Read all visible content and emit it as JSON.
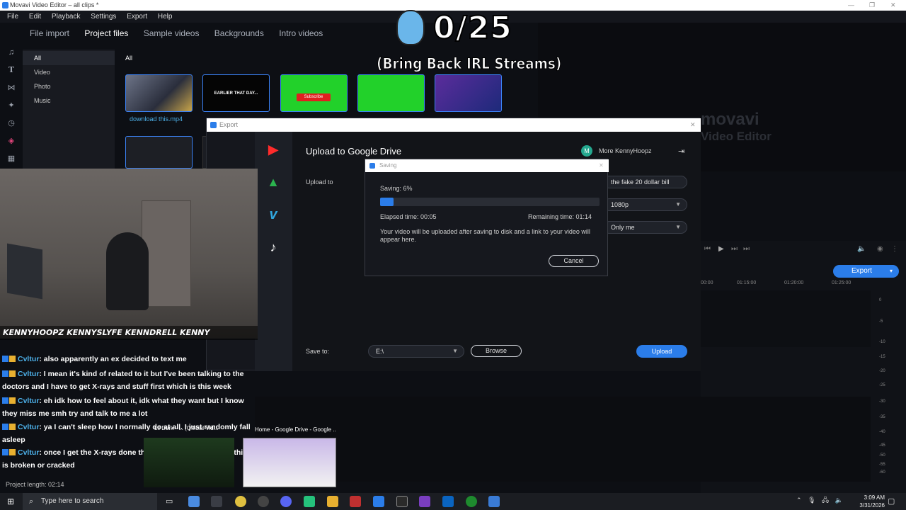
{
  "window": {
    "title": "Movavi Video Editor – all clips *"
  },
  "menu": [
    "File",
    "Edit",
    "Playback",
    "Settings",
    "Export",
    "Help"
  ],
  "import_tabs": {
    "t0": "File import",
    "t1": "Project files",
    "t2": "Sample videos",
    "t3": "Backgrounds",
    "t4": "Intro videos"
  },
  "side_filters": {
    "f0": "All",
    "f1": "Video",
    "f2": "Photo",
    "f3": "Music"
  },
  "media": {
    "header": "All",
    "clip0_name": "download this.mp4",
    "clip1_text": "EARLIER THAT DAY...",
    "clip2_text": "Subscribe"
  },
  "overlay": {
    "counter": "0/25",
    "banner": "(Bring Back IRL Streams)"
  },
  "watermark": {
    "line1": "movavi",
    "line2": "Video Editor"
  },
  "export_dialog": {
    "title": "Export",
    "heading": "Upload to Google Drive",
    "account_initial": "M",
    "account_label": "More KennyHoopz",
    "upload_to_label": "Upload to",
    "title_value": "the fake 20 dollar bill",
    "resolution_value": "1080p",
    "privacy_value": "Only me",
    "save_to_label": "Save to:",
    "save_path": "E:\\",
    "browse_label": "Browse",
    "upload_label": "Upload"
  },
  "saving_dialog": {
    "title": "Saving",
    "saving_label": "Saving:  6%",
    "progress": 0.06,
    "elapsed": "Elapsed time:  00:05",
    "remaining": "Remaining time:  01:14",
    "message": "Your video will be uploaded after saving to disk and a link to your video will appear here.",
    "cancel_label": "Cancel"
  },
  "timeline": {
    "export_label": "Export",
    "ruler": {
      "r0": "00:00",
      "r1": "01:15:00",
      "r2": "01:20:00",
      "r3": "01:25:00"
    },
    "vu": {
      "v0": "0",
      "v1": "-5",
      "v2": "-10",
      "v3": "-15",
      "v4": "-20",
      "v5": "-25",
      "v6": "-30",
      "v7": "-35",
      "v8": "-40",
      "v9": "-45",
      "v10": "-50",
      "v11": "-55",
      "v12": "-60"
    },
    "project_length": "Project length: 02:14"
  },
  "stream_overlay": {
    "social": "KENNYHOOPZ  KENNYSLYFE  KENNDRELL  KENNY"
  },
  "chat": {
    "m0": {
      "name": "Cvltur",
      "text": ": also apparently an ex decided to text me"
    },
    "m1": {
      "name": "Cvltur",
      "text": ": I mean it's kind of related to it but I've been talking to the doctors and I have to get X-rays and stuff first which is this week"
    },
    "m2": {
      "name": "Cvltur",
      "text": ": eh idk how to feel about it, idk what they want but I know they miss me smh try and talk to me a lot"
    },
    "m3": {
      "name": "Cvltur",
      "text": ": ya I can't sleep how I normally do at all. I just randomly fall asleep"
    },
    "m4": {
      "name": "Cvltur",
      "text": ": once I get the X-rays done this week I'll text you if anything is broken or cracked"
    }
  },
  "taskbar_preview": {
    "label0": "Lil Durk - ... (Official Vid...",
    "label1": "Home - Google Drive - Google ..."
  },
  "taskbar": {
    "search_placeholder": "Type here to search",
    "time": "3:09 AM",
    "date": "3/31/2026"
  },
  "colors": {
    "accent": "#2b7de9",
    "chat_name": "#4db1ea",
    "bg": "#0d0f14"
  }
}
